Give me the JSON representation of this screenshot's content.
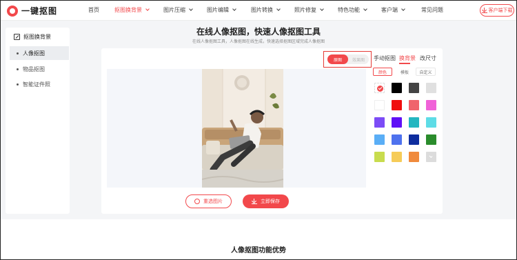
{
  "header": {
    "logo_text": "一键抠图",
    "nav": [
      {
        "label": "首页",
        "has_dropdown": false,
        "active": false
      },
      {
        "label": "抠图换背景",
        "has_dropdown": true,
        "active": true
      },
      {
        "label": "图片压缩",
        "has_dropdown": true,
        "active": false
      },
      {
        "label": "图片编辑",
        "has_dropdown": true,
        "active": false
      },
      {
        "label": "图片转换",
        "has_dropdown": true,
        "active": false
      },
      {
        "label": "照片修复",
        "has_dropdown": true,
        "active": false
      },
      {
        "label": "特色功能",
        "has_dropdown": true,
        "active": false
      },
      {
        "label": "客户端",
        "has_dropdown": true,
        "active": false
      },
      {
        "label": "常见问题",
        "has_dropdown": false,
        "active": false
      }
    ],
    "download_label": "客户端下载"
  },
  "sidebar": {
    "title": "抠图换背景",
    "items": [
      {
        "label": "人像抠图",
        "active": true
      },
      {
        "label": "物品抠图",
        "active": false
      },
      {
        "label": "智能证件照",
        "active": false
      }
    ]
  },
  "page": {
    "title": "在线人像抠图，快速人像抠图工具",
    "subtitle": "在线人像抠图工具，人像抠图在线生成，快速选择抠图区域完成人像抠图"
  },
  "editor": {
    "toggle": {
      "on_label": "原图",
      "off_label": "效果图"
    },
    "tool_tabs": [
      {
        "label": "手动抠图",
        "active": false
      },
      {
        "label": "换背景",
        "active": true
      },
      {
        "label": "改尺寸",
        "active": false
      }
    ],
    "sub_tabs": [
      {
        "label": "颜色",
        "active": true
      },
      {
        "label": "模板",
        "active": false
      },
      {
        "label": "自定义",
        "active": false
      }
    ],
    "swatches": [
      {
        "color": "none",
        "selected": true
      },
      {
        "color": "#000000"
      },
      {
        "color": "#444444"
      },
      {
        "color": "#e0e0e0"
      },
      {
        "color": "#ffffff"
      },
      {
        "color": "#f00e0e"
      },
      {
        "color": "#f0646c"
      },
      {
        "color": "#f062d8"
      },
      {
        "color": "#7c4cf6"
      },
      {
        "color": "#6010f6"
      },
      {
        "color": "#24b6c0"
      },
      {
        "color": "#5edce6"
      },
      {
        "color": "#5aaef6"
      },
      {
        "color": "#4e72ee"
      },
      {
        "color": "#0e2d9e"
      },
      {
        "color": "#2a8c2c"
      },
      {
        "color": "#c8dc4e"
      },
      {
        "color": "#f6cc58"
      },
      {
        "color": "#f08a3c"
      },
      {
        "color": "add",
        "icon": "check-icon"
      }
    ],
    "reselect_label": "重选图片",
    "save_label": "立即保存"
  },
  "bottom": {
    "title": "人像抠图功能优势"
  },
  "colors": {
    "accent": "#f2484b"
  }
}
